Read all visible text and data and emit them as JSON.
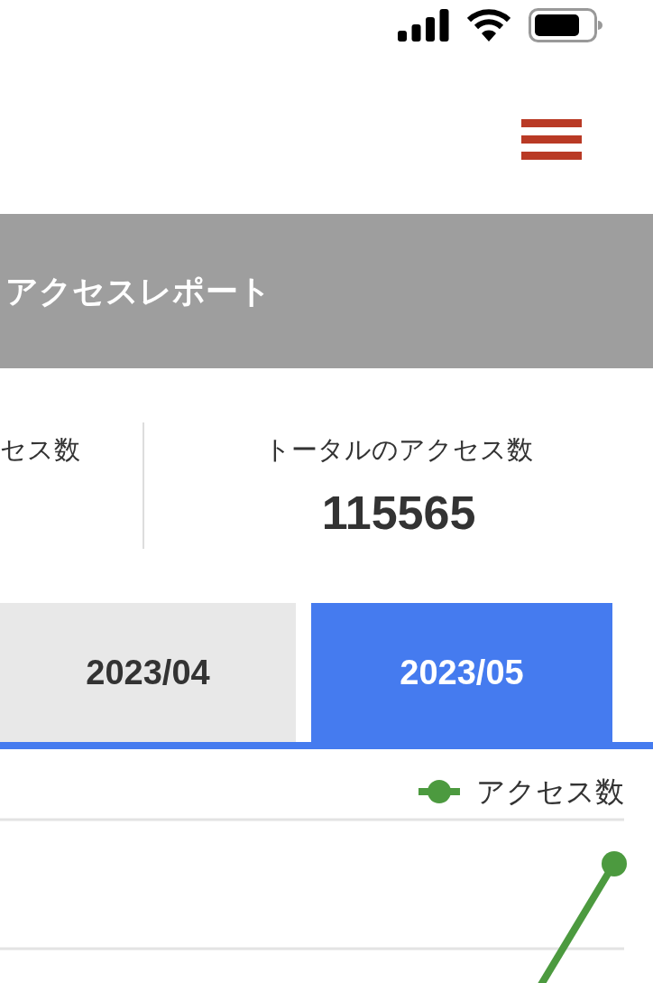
{
  "page_title": "アクセスレポート",
  "stats": [
    {
      "label": "セス数"
    },
    {
      "label": "トータルのアクセス数",
      "value": "115565"
    }
  ],
  "tabs": [
    {
      "label": "2023/04",
      "selected": false
    },
    {
      "label": "2023/05",
      "selected": true
    }
  ],
  "chart": {
    "legend": [
      {
        "name": "アクセス数",
        "color": "#4c9a3f"
      }
    ]
  }
}
